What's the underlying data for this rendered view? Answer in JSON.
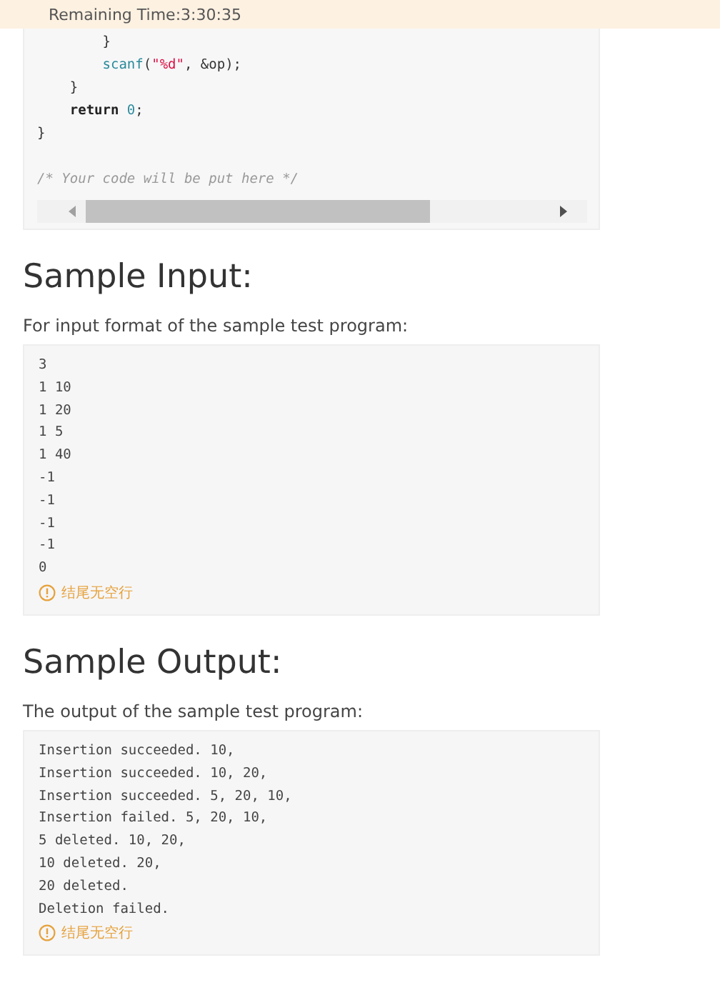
{
  "banner": {
    "text": "Remaining Time:3:30:35"
  },
  "code": {
    "lines": [
      [
        {
          "kind": "plain",
          "text": "        }"
        }
      ],
      [
        {
          "kind": "func",
          "text": "        scanf"
        },
        {
          "kind": "plain",
          "text": "("
        },
        {
          "kind": "string",
          "text": "\"%d\""
        },
        {
          "kind": "plain",
          "text": ", &op);"
        }
      ],
      [
        {
          "kind": "plain",
          "text": "    }"
        }
      ],
      [
        {
          "kind": "keyword",
          "text": "    return "
        },
        {
          "kind": "number",
          "text": "0"
        },
        {
          "kind": "plain",
          "text": ";"
        }
      ],
      [
        {
          "kind": "plain",
          "text": "}"
        }
      ]
    ],
    "comment": "/* Your code will be put here */"
  },
  "sections": [
    {
      "heading": "Sample Input:",
      "description": "For input format of the sample test program:",
      "lines": [
        "3",
        "1 10",
        "1 20",
        "1 5",
        "1 40",
        "-1",
        "-1",
        "-1",
        "-1",
        "0"
      ],
      "note": "结尾无空行"
    },
    {
      "heading": "Sample Output:",
      "description": "The output of the sample test program:",
      "lines": [
        "Insertion succeeded. 10,",
        "Insertion succeeded. 10, 20,",
        "Insertion succeeded. 5, 20, 10,",
        "Insertion failed. 5, 20, 10,",
        "5 deleted. 10, 20,",
        "10 deleted. 20,",
        "20 deleted.",
        "Deletion failed."
      ],
      "note": "结尾无空行"
    }
  ]
}
